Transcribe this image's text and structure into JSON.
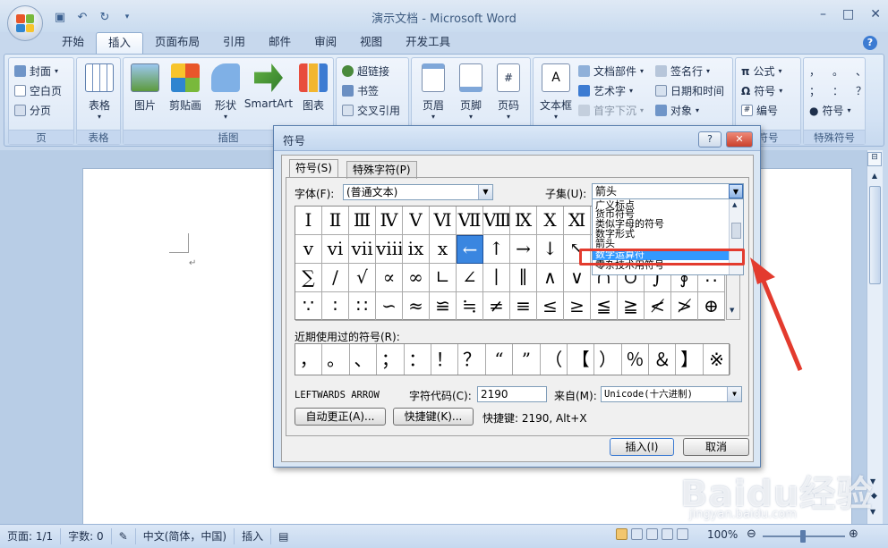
{
  "window": {
    "title": "演示文档 - Microsoft Word",
    "controls": [
      "–",
      "□",
      "✕"
    ]
  },
  "tabs": [
    "开始",
    "插入",
    "页面布局",
    "引用",
    "邮件",
    "审阅",
    "视图",
    "开发工具"
  ],
  "ribbon": {
    "pages": {
      "label": "页",
      "items": [
        "封面",
        "空白页",
        "分页"
      ]
    },
    "tables": {
      "label": "表格",
      "button": "表格"
    },
    "illustrations": {
      "label": "插图",
      "buttons": [
        "图片",
        "剪贴画",
        "形状",
        "SmartArt",
        "图表"
      ]
    },
    "links": {
      "items": [
        "超链接",
        "书签",
        "交叉引用"
      ]
    },
    "header_footer": {
      "buttons": [
        "页眉",
        "页脚",
        "页码"
      ]
    },
    "text": {
      "button": "文本框",
      "items": [
        "文档部件",
        "艺术字",
        "首字下沉",
        "签名行",
        "日期和时间",
        "对象"
      ]
    },
    "symbols": {
      "label": "符号",
      "items": [
        "公式",
        "符号",
        "编号"
      ]
    },
    "special": {
      "label": "特殊符号",
      "chars": [
        "，",
        "。",
        "、",
        "；",
        "：",
        "？"
      ],
      "button": "符号"
    }
  },
  "dialog": {
    "title": "符号",
    "help": "?",
    "tab_symbols": "符号(S)",
    "tab_special": "特殊字符(P)",
    "font_label": "字体(F):",
    "font_value": "(普通文本)",
    "subset_label": "子集(U):",
    "subset_value": "箭头",
    "subset_list": [
      "广义标点",
      "货币符号",
      "类似字母的符号",
      "数字形式",
      "箭头",
      "数学运算符",
      "零杂技术用符号"
    ],
    "symbol_rows": [
      [
        "Ⅰ",
        "Ⅱ",
        "Ⅲ",
        "Ⅳ",
        "Ⅴ",
        "Ⅵ",
        "Ⅶ",
        "Ⅷ",
        "Ⅸ",
        "Ⅹ",
        "Ⅺ",
        "",
        "",
        "",
        "",
        ""
      ],
      [
        "ⅴ",
        "ⅵ",
        "ⅶ",
        "ⅷ",
        "ⅸ",
        "ⅹ",
        "←",
        "↑",
        "→",
        "↓",
        "↖",
        "",
        "",
        "",
        "",
        ""
      ],
      [
        "∑",
        "∕",
        "√",
        "∝",
        "∞",
        "∟",
        "∠",
        "∣",
        "∥",
        "∧",
        "∨",
        "∩",
        "∪",
        "∫",
        "∮",
        "∴"
      ],
      [
        "∵",
        "∶",
        "∷",
        "∽",
        "≈",
        "≌",
        "≒",
        "≠",
        "≡",
        "≤",
        "≥",
        "≦",
        "≧",
        "≮",
        "≯",
        "⊕"
      ]
    ],
    "recent_label": "近期使用过的符号(R):",
    "recent": [
      "，",
      "。",
      "、",
      "；",
      "：",
      "！",
      "？",
      "“",
      "”",
      "（",
      "【",
      "）",
      "％",
      "＆",
      "】",
      "※"
    ],
    "char_name": "LEFTWARDS ARROW",
    "char_code_label": "字符代码(C):",
    "char_code": "2190",
    "from_label": "来自(M):",
    "from_value": "Unicode(十六进制)",
    "autocorrect": "自动更正(A)...",
    "shortcut_btn": "快捷键(K)...",
    "shortcut_text": "快捷键: 2190, Alt+X",
    "insert": "插入(I)",
    "cancel": "取消"
  },
  "status": {
    "page": "页面: 1/1",
    "words": "字数: 0",
    "language": "中文(简体，中国)",
    "mode": "插入",
    "zoom": "100%"
  },
  "watermark": {
    "main": "Baidu经验",
    "sub": "jingyan.baidu.com"
  },
  "colors": {
    "selection": "#3a86e0",
    "highlight": "#e33b2e",
    "list_highlight": "#3399ff"
  }
}
